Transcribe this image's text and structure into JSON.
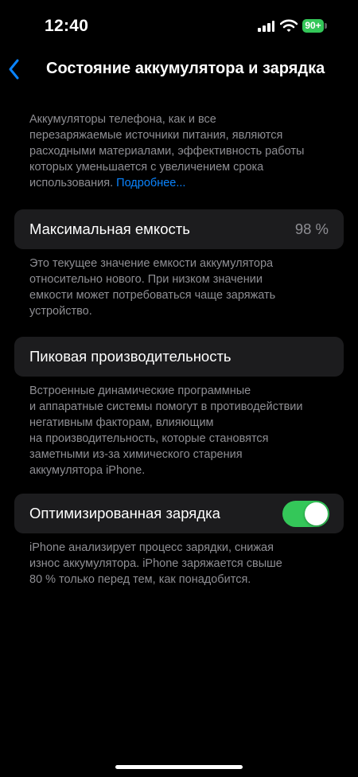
{
  "status_bar": {
    "time": "12:40",
    "battery_level": "90+",
    "battery_color": "#34c759",
    "icons": [
      "signal-icon",
      "wifi-icon",
      "battery-icon"
    ]
  },
  "nav": {
    "back_icon": "chevron-left-icon",
    "title": "Состояние аккумулятора и зарядка",
    "accent_color": "#0a84ff"
  },
  "intro": {
    "lines": [
      "Аккумуляторы телефона, как и все",
      "перезаряжаемые источники питания, являются",
      "расходными материалами, эффективность работы",
      "которых уменьшается с увеличением срока",
      "использования."
    ],
    "learn_more": "Подробнее..."
  },
  "max_capacity": {
    "label": "Максимальная емкость",
    "value": "98 %",
    "footer_lines": [
      "Это текущее значение емкости аккумулятора",
      "относительно нового. При низком значении",
      "емкости может потребоваться чаще заряжать",
      "устройство."
    ]
  },
  "peak_performance": {
    "label": "Пиковая производительность",
    "footer_lines": [
      "Встроенные динамические программные",
      "и аппаратные системы помогут в противодействии",
      "негативным факторам, влияющим",
      "на производительность, которые становятся",
      "заметными из-за химического старения",
      "аккумулятора iPhone."
    ]
  },
  "optimized_charging": {
    "label": "Оптимизированная зарядка",
    "enabled": true,
    "toggle_color": "#34c759",
    "footer_lines": [
      "iPhone анализирует процесс зарядки, снижая",
      "износ аккумулятора. iPhone заряжается свыше",
      "80 % только перед тем, как понадобится."
    ]
  }
}
